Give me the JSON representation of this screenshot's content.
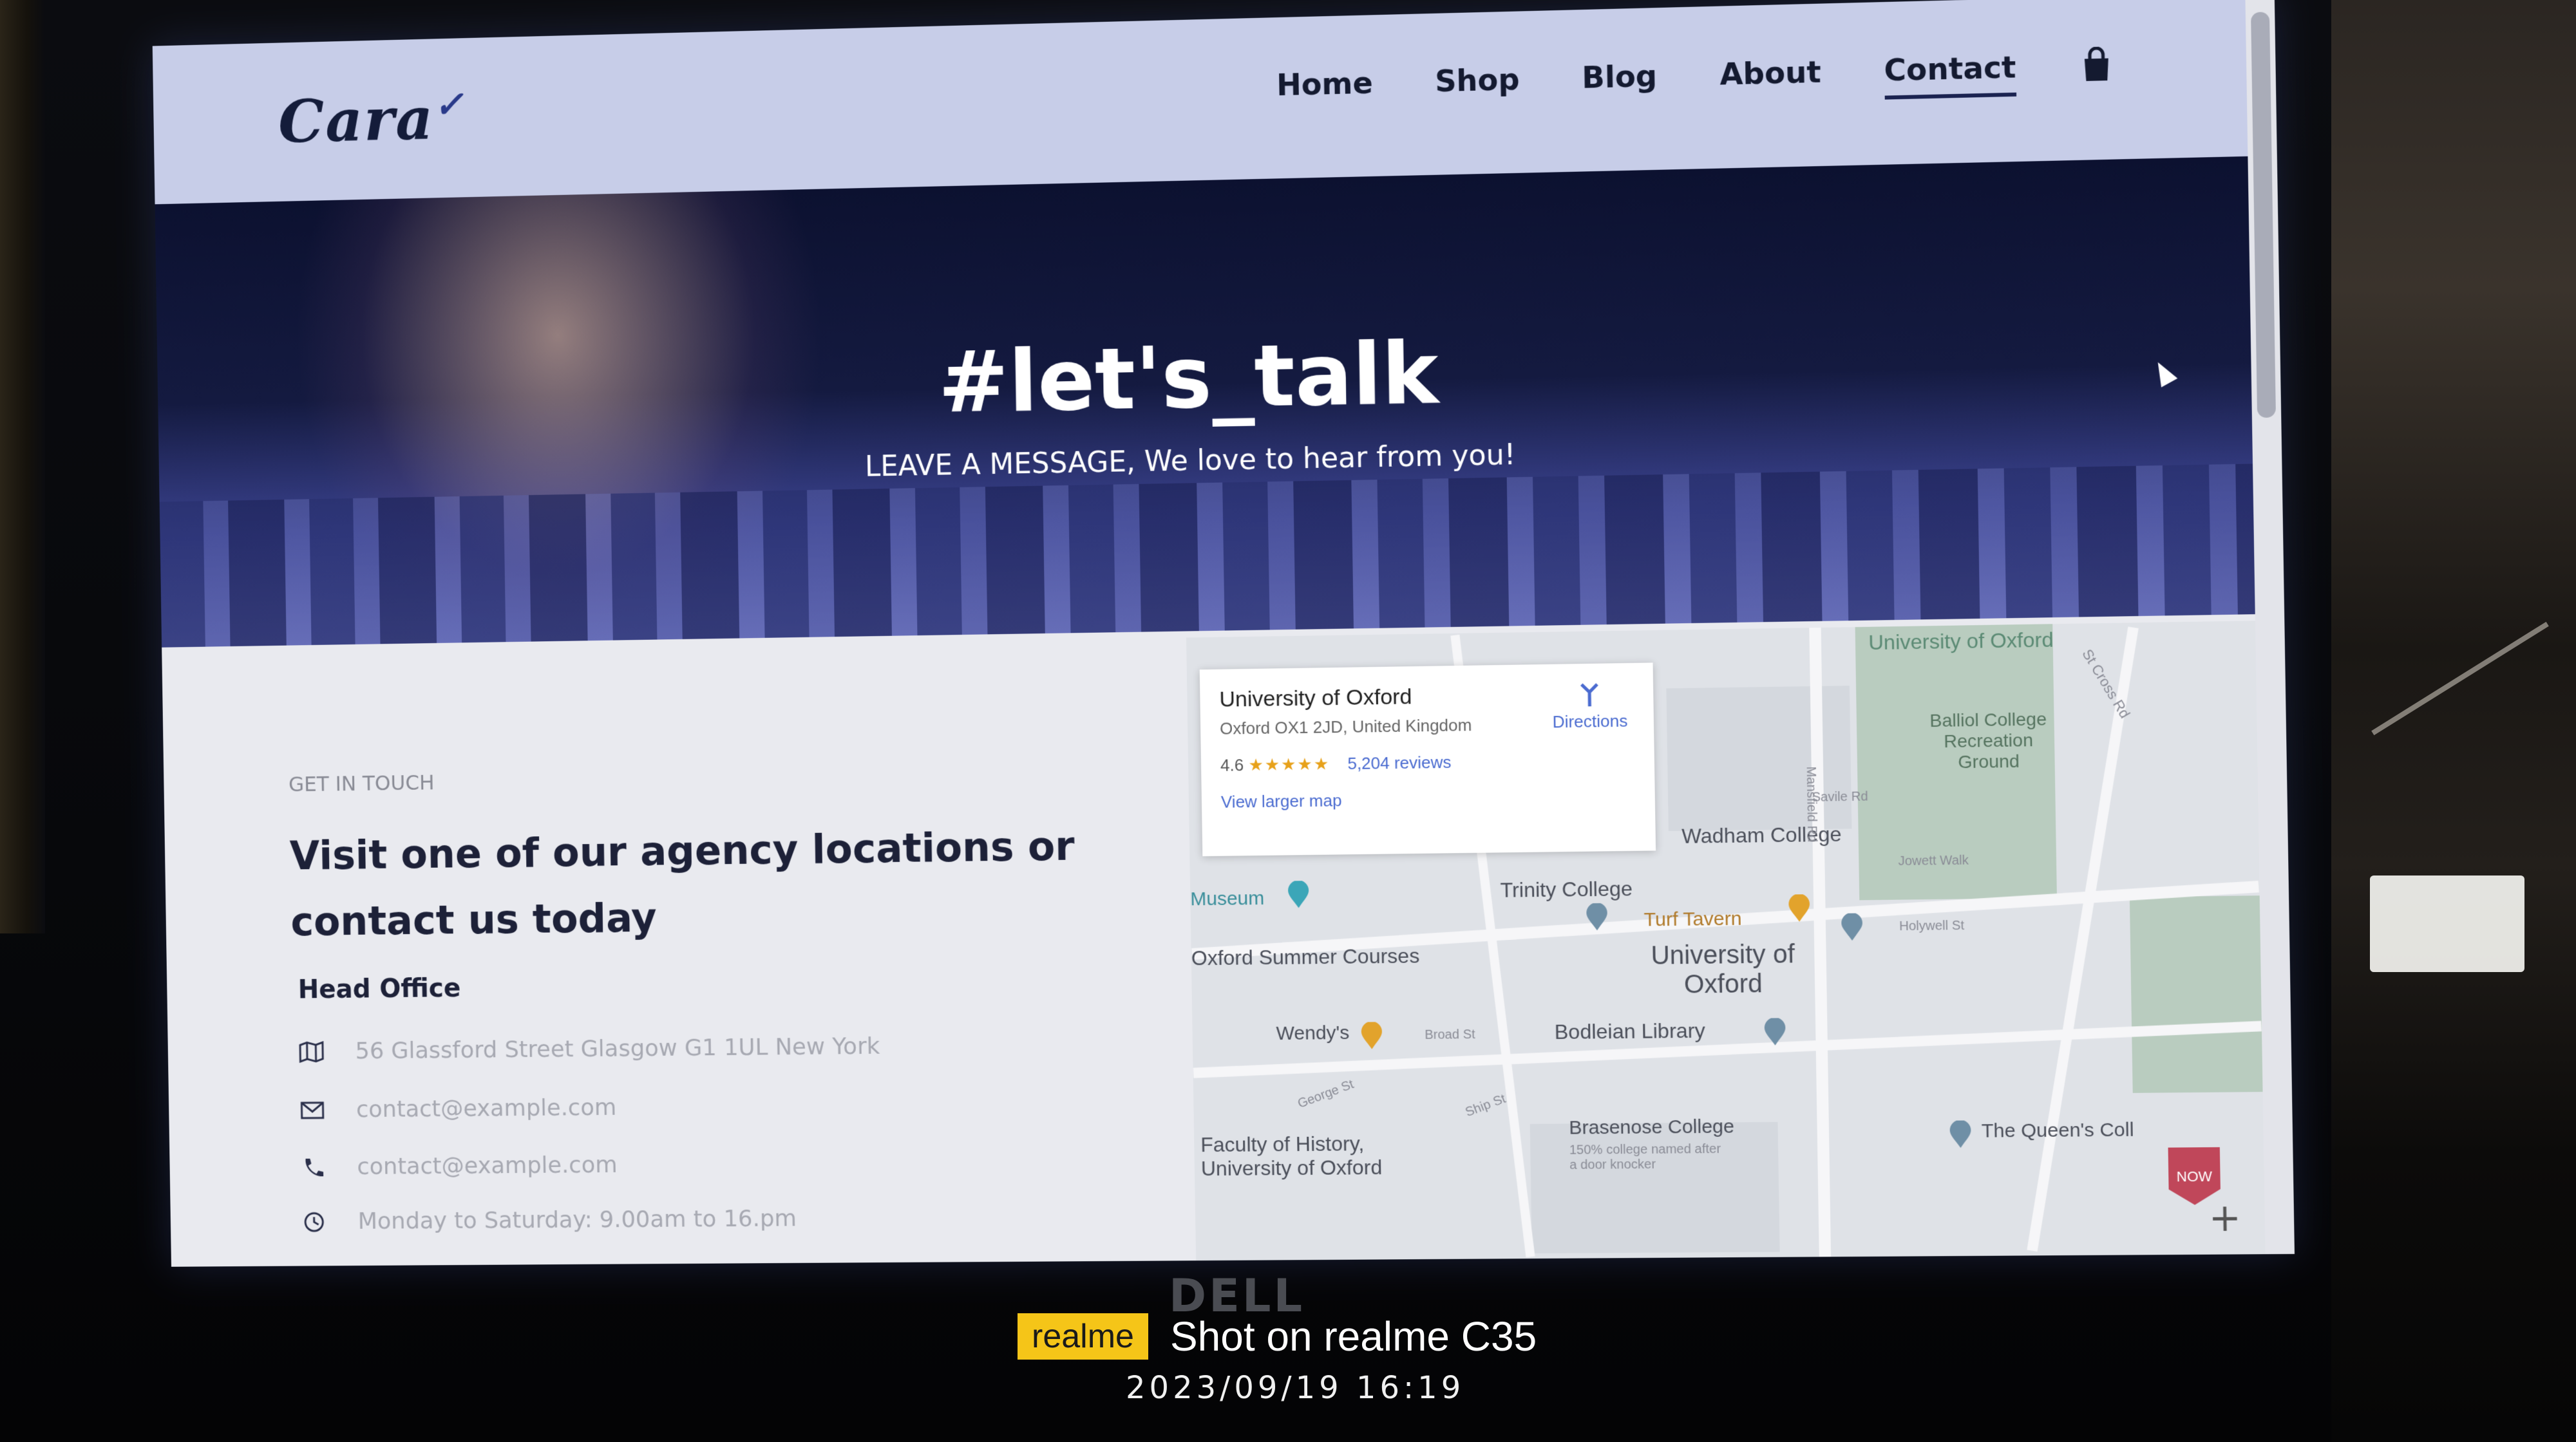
{
  "brand": {
    "logo_text": "Cara"
  },
  "nav": {
    "items": [
      "Home",
      "Shop",
      "Blog",
      "About",
      "Contact"
    ],
    "active": "Contact"
  },
  "hero": {
    "title": "#let's_talk",
    "subtitle": "LEAVE A MESSAGE, We love to hear from you!"
  },
  "contact": {
    "eyebrow": "GET IN TOUCH",
    "heading": "Visit one of our agency locations or contact us today",
    "subheading": "Head Office",
    "address": "56 Glassford Street Glasgow G1 1UL New York",
    "email": "contact@example.com",
    "phone": "contact@example.com",
    "hours": "Monday to Saturday: 9.00am to 16.pm"
  },
  "map": {
    "card": {
      "title": "University of Oxford",
      "address": "Oxford OX1 2JD, United Kingdom",
      "rating": "4.6",
      "stars": "★★★★★",
      "reviews": "5,204 reviews",
      "link": "View larger map",
      "directions": "Directions"
    },
    "labels": {
      "top": "University of Oxford",
      "balliol": "Balliol College Recreation Ground",
      "wadham": "Wadham College",
      "museum": "Museum",
      "trinity": "Trinity College",
      "turf": "Turf Tavern",
      "university": "University of Oxford",
      "summer": "Oxford Summer Courses",
      "wendys": "Wendy's",
      "bodleian": "Bodleian Library",
      "faculty": "Faculty of History, University of Oxford",
      "brasenose": "Brasenose College",
      "brasenose_note": "150% college named after a door knocker",
      "queens": "The Queen's Coll",
      "broad_st": "Broad St",
      "holywell": "Holywell St",
      "st_cross": "St Cross Rd",
      "mansfield": "Mansfield Rd",
      "jowett": "Jowett Walk",
      "savile": "Savile Rd",
      "george": "George St",
      "ship": "Ship St"
    },
    "badge": "NOW"
  },
  "photo": {
    "monitor_brand": "DELL",
    "camera_badge": "realme",
    "camera_text": "Shot on realme C35",
    "timestamp": "2023/09/19  16:19"
  },
  "colors": {
    "header_bg": "#c7cde8",
    "hero_dark": "#0c1130",
    "accent_navy": "#1a2250",
    "realme_yellow": "#f5c518"
  }
}
